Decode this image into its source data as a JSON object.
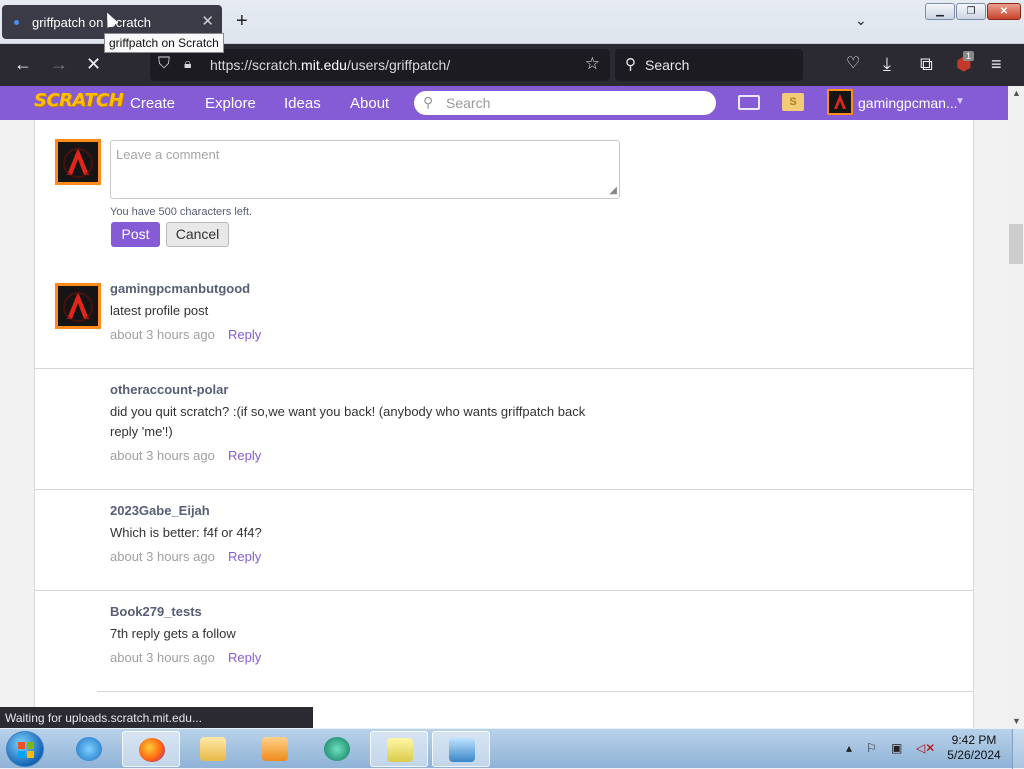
{
  "browser": {
    "tab_title": "griffpatch on Scratch",
    "tooltip": "griffpatch on Scratch",
    "url_prefix": "https://scratch.",
    "url_domain": "mit.edu",
    "url_path": "/users/griffpatch/",
    "search_placeholder": "Search",
    "extension_badge": "1",
    "status_text": "Waiting for uploads.scratch.mit.edu..."
  },
  "scratch_nav": {
    "logo": "SCRATCH",
    "links": [
      "Create",
      "Explore",
      "Ideas",
      "About"
    ],
    "search_placeholder": "Search",
    "username": "gamingpcman...",
    "mystuff_glyph": "S"
  },
  "composer": {
    "placeholder": "Leave a comment",
    "chars_left": "You have 500 characters left.",
    "post_label": "Post",
    "cancel_label": "Cancel"
  },
  "comments": [
    {
      "author": "gamingpcmanbutgood",
      "body": "latest profile post",
      "time": "about 3 hours ago",
      "reply": "Reply",
      "has_avatar": true
    },
    {
      "author": "otheraccount-polar",
      "body": "did you quit scratch? :(if so,we want you back! (anybody who wants griffpatch back reply 'me'!)",
      "time": "about 3 hours ago",
      "reply": "Reply",
      "has_avatar": false
    },
    {
      "author": "2023Gabe_Eijah",
      "body": "Which is better: f4f or 4f4?",
      "time": "about 3 hours ago",
      "reply": "Reply",
      "has_avatar": false
    },
    {
      "author": "Book279_tests",
      "body": "7th reply gets a follow",
      "time": "about 3 hours ago",
      "reply": "Reply",
      "has_avatar": false
    }
  ],
  "taskbar": {
    "time": "9:42 PM",
    "date": "5/26/2024"
  },
  "colors": {
    "scratch_purple": "#855cd6",
    "browser_dark": "#2b2a33",
    "avatar_border": "#ff8b1a"
  }
}
